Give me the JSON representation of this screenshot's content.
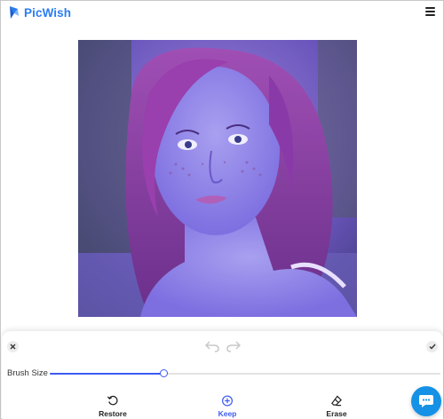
{
  "header": {
    "logo_text": "PicWish",
    "brand_color": "#2a7df0",
    "menu_icon": "hamburger-menu-icon"
  },
  "canvas": {
    "image_description_icon": "edited-photo",
    "overlay_color": "#5a3fd0"
  },
  "panel": {
    "close_icon": "close-icon",
    "undo_icon": "undo-icon",
    "redo_icon": "redo-icon",
    "confirm_icon": "checkmark-icon",
    "brush": {
      "label": "Brush Size",
      "value_fraction": 0.29,
      "accent": "#3d5af1"
    },
    "tools": [
      {
        "label": "Restore",
        "icon": "restore-icon",
        "active": false
      },
      {
        "label": "Keep",
        "icon": "plus-circle-icon",
        "active": true
      },
      {
        "label": "Erase",
        "icon": "eraser-icon",
        "active": false
      }
    ]
  },
  "chat": {
    "icon": "chat-bubble-icon",
    "color": "#1592e6"
  }
}
